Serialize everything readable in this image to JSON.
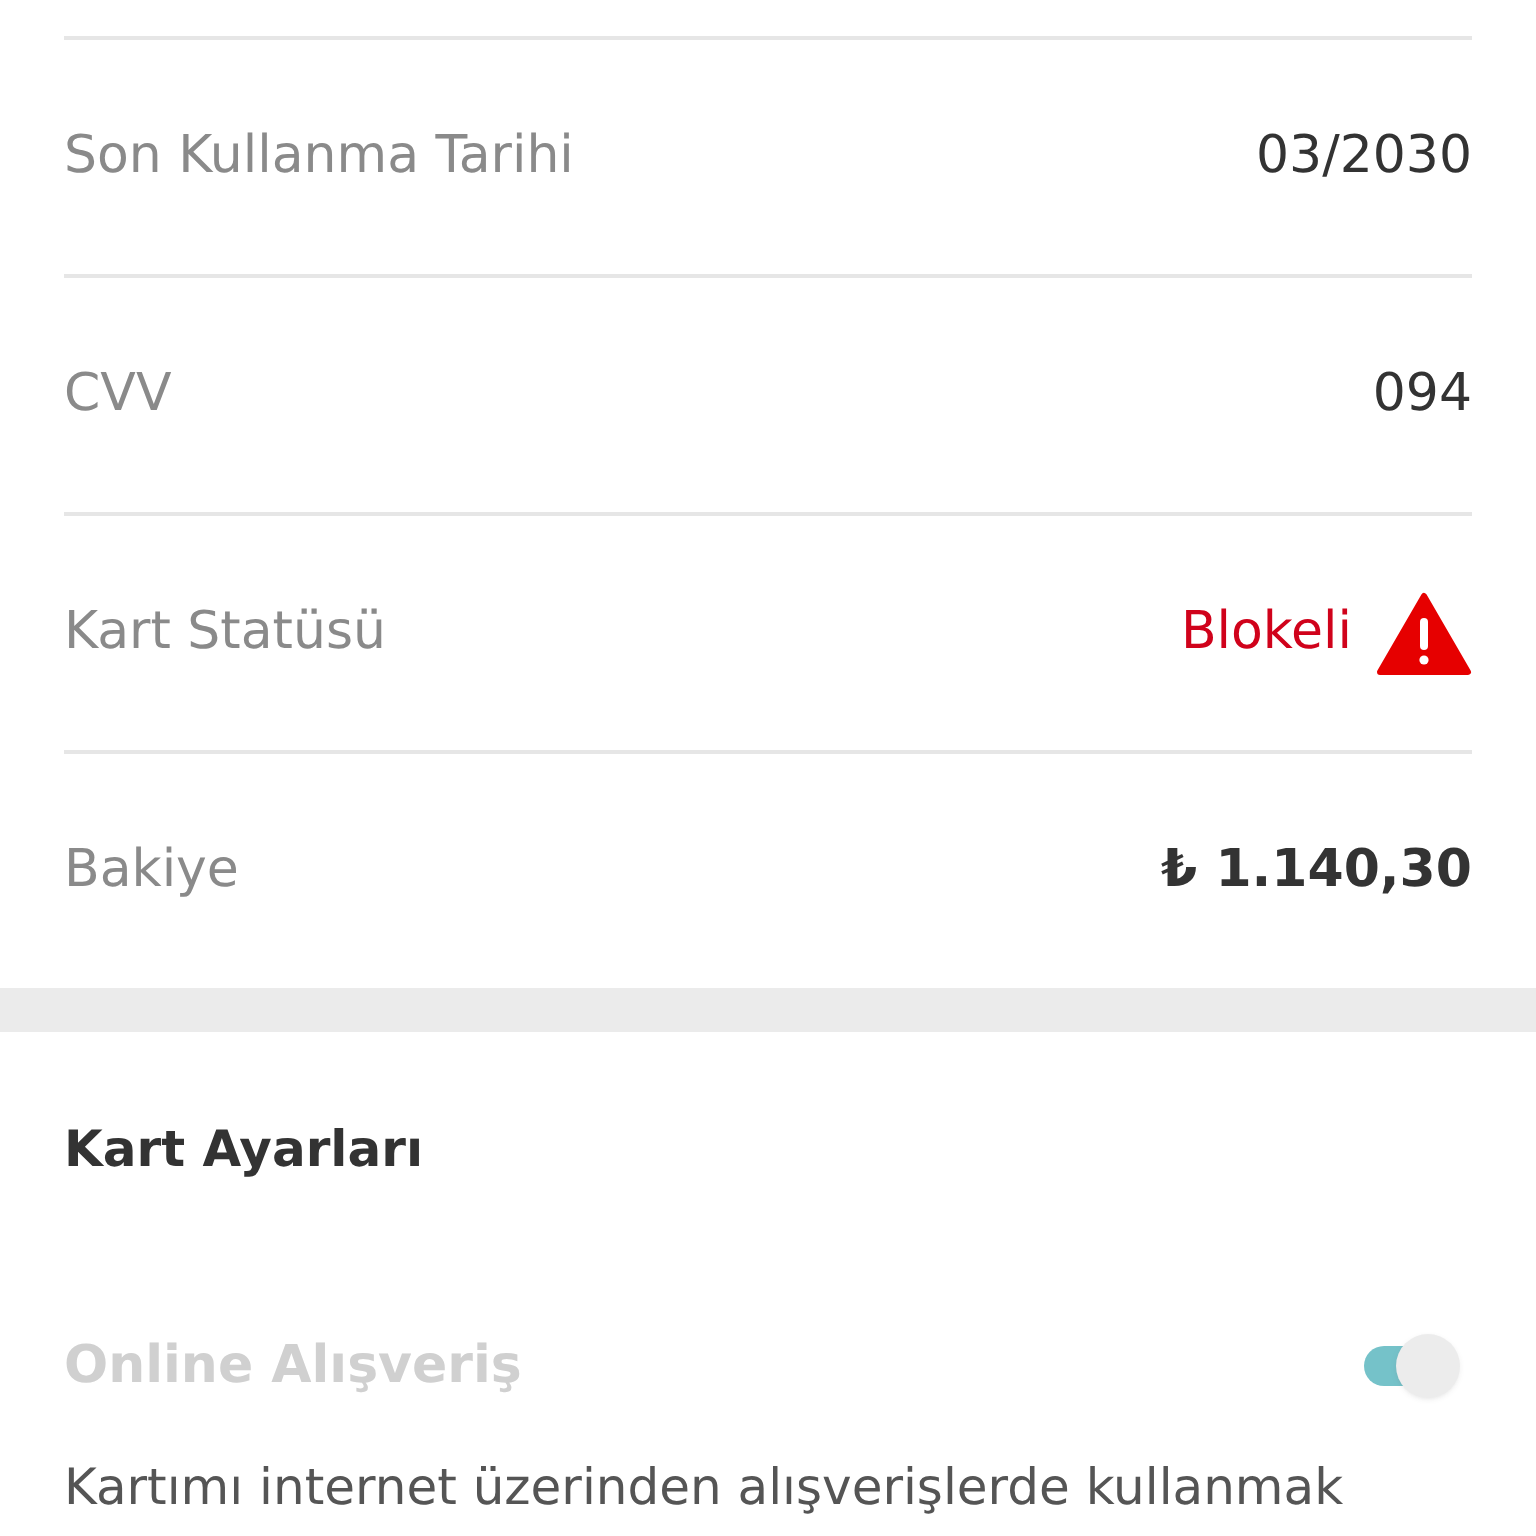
{
  "details": [
    {
      "kind": "text",
      "label": "Son Kullanma Tarihi",
      "value": "03/2030"
    },
    {
      "kind": "text",
      "label": "CVV",
      "value": "094"
    },
    {
      "kind": "status",
      "label": "Kart Statüsü",
      "value": "Blokeli"
    },
    {
      "kind": "amount",
      "label": "Bakiye",
      "value": "₺ 1.140,30"
    }
  ],
  "settings": {
    "title": "Kart Ayarları",
    "items": [
      {
        "label": "Online Alışveriş",
        "on": true,
        "disabled": true,
        "description": "Kartımı internet üzerinden alışverişlerde kullanmak"
      }
    ]
  }
}
